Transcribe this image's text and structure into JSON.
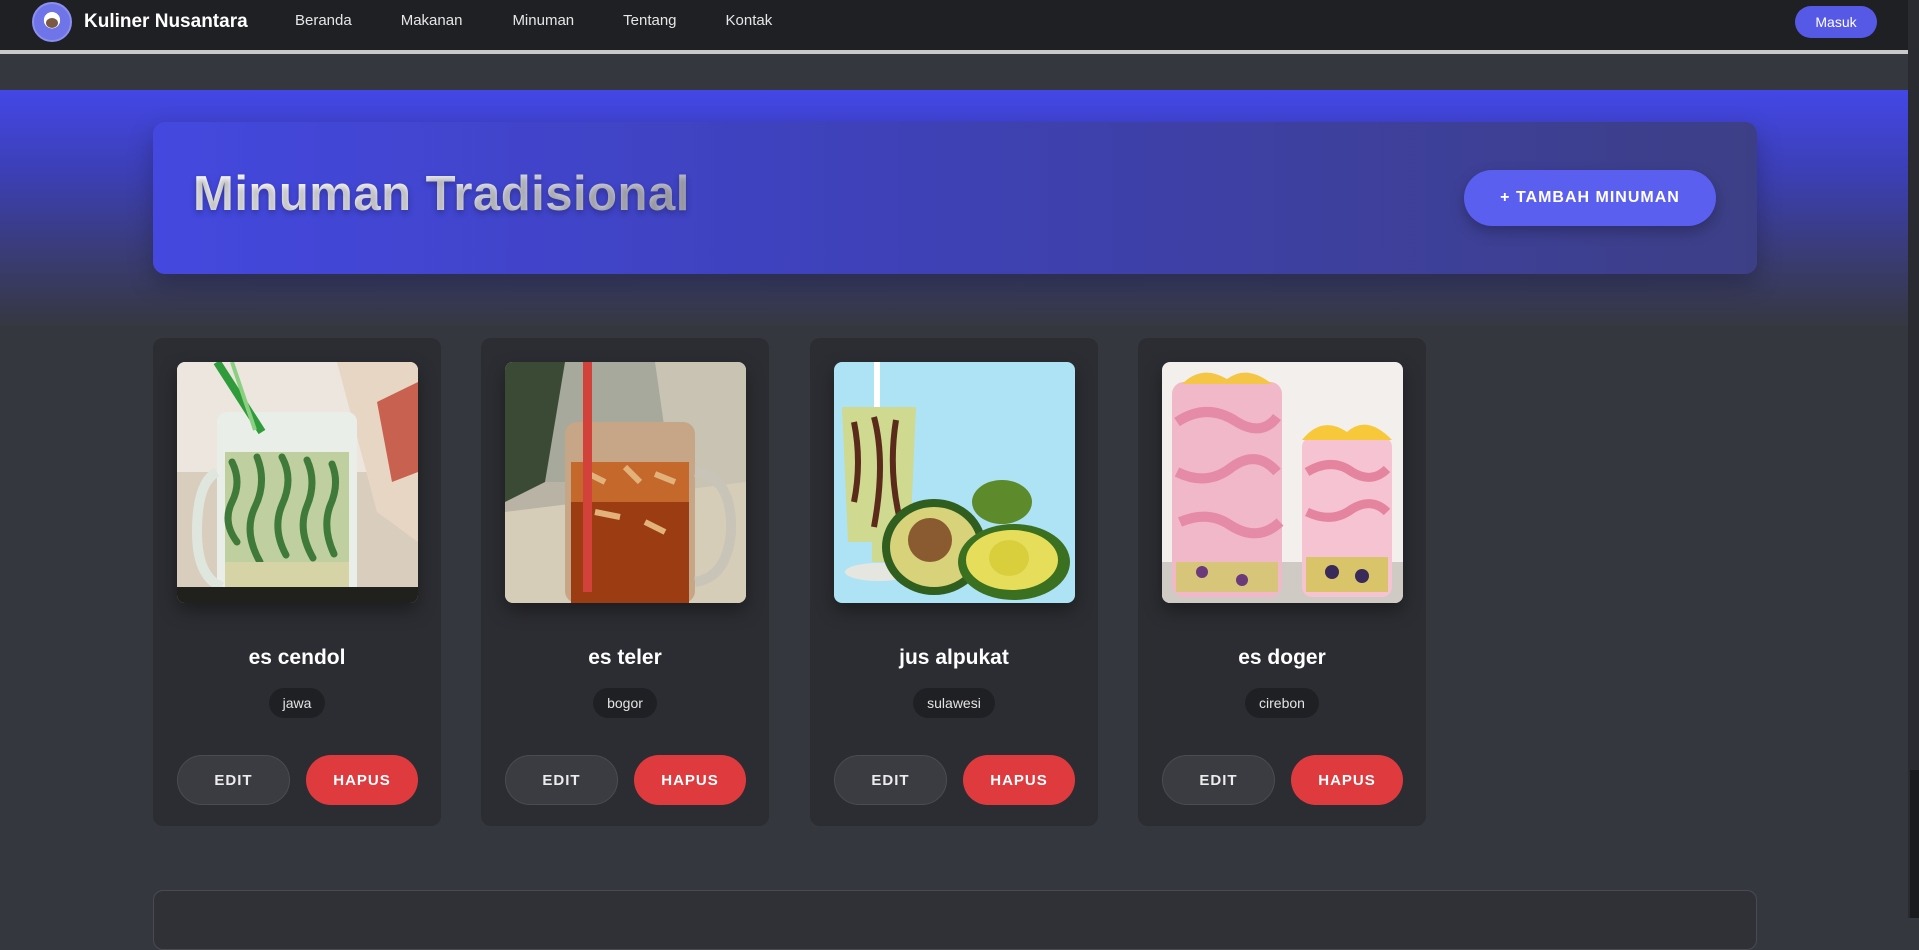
{
  "navbar": {
    "brand": "Kuliner Nusantara",
    "links": [
      "Beranda",
      "Makanan",
      "Minuman",
      "Tentang",
      "Kontak"
    ],
    "login_label": "Masuk"
  },
  "hero": {
    "title": "Minuman Tradisional",
    "add_button": "+ TAMBAH MINUMAN"
  },
  "drinks": [
    {
      "name": "es cendol",
      "region": "jawa"
    },
    {
      "name": "es teler",
      "region": "bogor"
    },
    {
      "name": "jus alpukat",
      "region": "sulawesi"
    },
    {
      "name": "es doger",
      "region": "cirebon"
    }
  ],
  "actions": {
    "edit": "EDIT",
    "delete": "HAPUS"
  },
  "colors": {
    "accent": "#5658e6",
    "danger": "#df3b3f",
    "background": "#35373e",
    "card": "#2c2d32"
  }
}
